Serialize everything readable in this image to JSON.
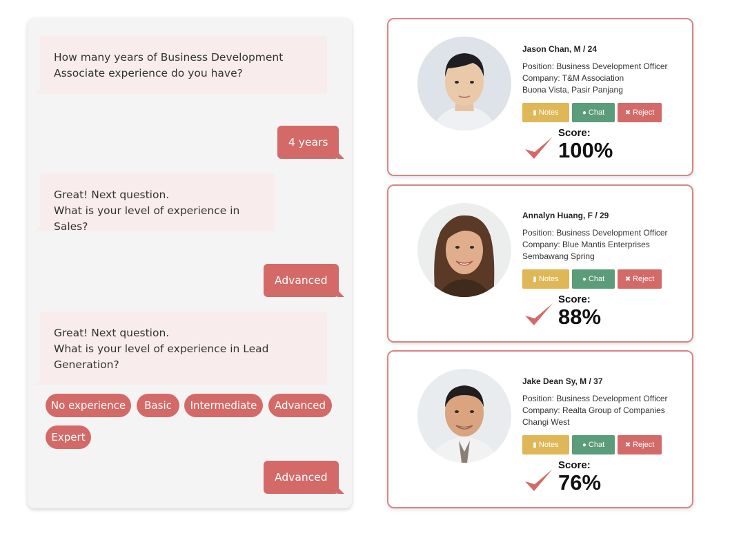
{
  "chat": {
    "q1": [
      "How many years of Business Development",
      "Associate experience do you have?"
    ],
    "a1": "4 years",
    "q2": [
      "Great! Next question.",
      "What is your level of experience in Sales?"
    ],
    "a2": "Advanced",
    "q3": [
      "Great! Next question.",
      "What is your level of experience in Lead",
      "Generation?"
    ],
    "options": [
      "No experience",
      "Basic",
      "Intermediate",
      "Advanced",
      "Expert"
    ],
    "a3": "Advanced"
  },
  "buttons": {
    "notes": "Notes",
    "chat": "Chat",
    "reject": "Reject"
  },
  "score_label": "Score:",
  "candidates": [
    {
      "name": "Jason Chan, M / 24",
      "position": "Position: Business Development Officer",
      "company": "Company: T&M Association",
      "location": "Buona Vista, Pasir Panjang",
      "score": "100%"
    },
    {
      "name": "Annalyn Huang, F / 29",
      "position": "Position: Business Development Officer",
      "company": "Company: Blue Mantis Enterprises",
      "location": "Sembawang Spring",
      "score": "88%"
    },
    {
      "name": "Jake Dean Sy, M / 37",
      "position": "Position: Business Development Officer",
      "company": "Company: Realta Group of Companies",
      "location": "Changi West",
      "score": "76%"
    }
  ],
  "colors": {
    "accent": "#d46a68",
    "bot_bubble": "#f8ecec",
    "notes": "#e0b757",
    "chat": "#5b9c7a",
    "reject": "#d46a68",
    "card_border": "#d98483"
  },
  "icons": {
    "notes": "notes-icon",
    "chat": "chat-bubble-icon",
    "reject": "close-icon",
    "score": "checkmark-icon"
  }
}
